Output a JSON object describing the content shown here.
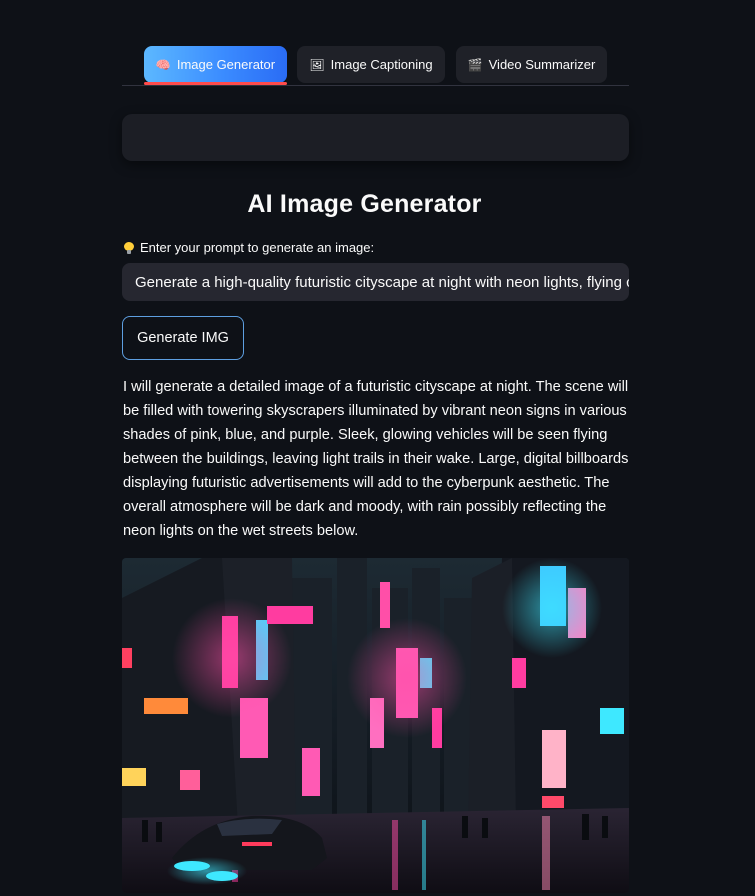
{
  "tabs": [
    {
      "label": "Image Generator",
      "icon": "brain-icon",
      "active": true
    },
    {
      "label": "Image Captioning",
      "icon": "picture-icon",
      "active": false
    },
    {
      "label": "Video Summarizer",
      "icon": "clapper-icon",
      "active": false
    }
  ],
  "page": {
    "title": "AI Image Generator",
    "prompt_label": "Enter your prompt to generate an image:",
    "prompt_value": "Generate a high-quality futuristic cityscape at night with neon lights, flying cars",
    "generate_button": "Generate IMG",
    "description": "I will generate a detailed image of a futuristic cityscape at night. The scene will be filled with towering skyscrapers illuminated by vibrant neon signs in various shades of pink, blue, and purple. Sleek, glowing vehicles will be seen flying between the buildings, leaving light trails in their wake. Large, digital billboards displaying futuristic advertisements will add to the cyberpunk aesthetic. The overall atmosphere will be dark and moody, with rain possibly reflecting the neon lights on the wet streets below."
  },
  "colors": {
    "background": "#0e1117",
    "tab_active_gradient_start": "#5cb8ff",
    "tab_active_gradient_end": "#2a6cf5",
    "tab_underline": "#ff4b4b",
    "button_border": "#5e9fe0",
    "neon_pink": "#ff3ca0",
    "neon_cyan": "#3ee8ff"
  }
}
